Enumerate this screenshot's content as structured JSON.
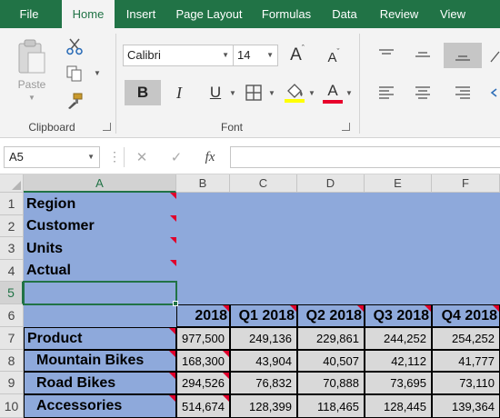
{
  "ribbon_tabs": [
    "File",
    "Home",
    "Insert",
    "Page Layout",
    "Formulas",
    "Data",
    "Review",
    "View"
  ],
  "clipboard": {
    "paste_label": "Paste",
    "group_label": "Clipboard"
  },
  "font": {
    "name": "Calibri",
    "size": "14",
    "group_label": "Font",
    "underline_color": "#e8002b",
    "fill_color": "#ffff00",
    "bold_glyph": "B",
    "italic_glyph": "I",
    "underline_glyph": "U",
    "font_color_glyph": "A"
  },
  "formula_bar": {
    "name_box": "A5",
    "cancel_glyph": "✕",
    "enter_glyph": "✓",
    "fx_label": "fx",
    "formula": ""
  },
  "grid": {
    "columns": [
      "A",
      "B",
      "C",
      "D",
      "E",
      "F"
    ],
    "rows": [
      "1",
      "2",
      "3",
      "4",
      "5",
      "6",
      "7",
      "8",
      "9",
      "10"
    ],
    "labels": [
      "Region",
      "Customer",
      "Units",
      "Actual"
    ],
    "headers": [
      "2018",
      "Q1 2018",
      "Q2 2018",
      "Q3 2018",
      "Q4 2018"
    ],
    "data_rows": [
      {
        "label": "Product",
        "values": [
          "977,500",
          "249,136",
          "229,861",
          "244,252",
          "254,252"
        ]
      },
      {
        "label": "Mountain Bikes",
        "values": [
          "168,300",
          "43,904",
          "40,507",
          "42,112",
          "41,777"
        ]
      },
      {
        "label": "Road Bikes",
        "values": [
          "294,526",
          "76,832",
          "70,888",
          "73,695",
          "73,110"
        ]
      },
      {
        "label": "Accessories",
        "values": [
          "514,674",
          "128,399",
          "118,465",
          "128,445",
          "139,364"
        ]
      }
    ]
  },
  "colors": {
    "accent": "#217346",
    "cell_blue": "#8ea9db",
    "cell_gray": "#d9d9d9",
    "marker_red": "#e0002b"
  }
}
